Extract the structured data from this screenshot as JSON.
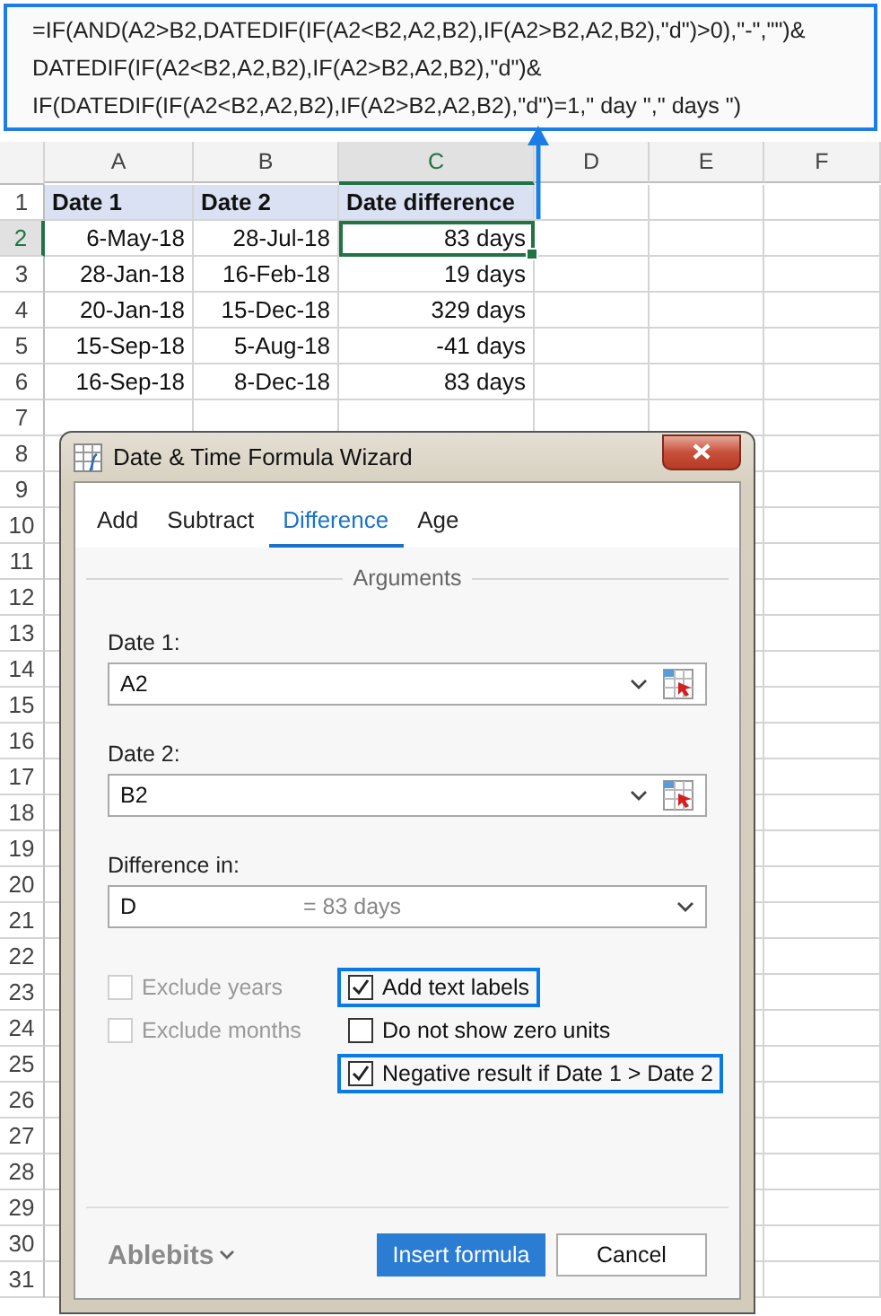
{
  "formula_box": {
    "lines": [
      "=IF(AND(A2>B2,DATEDIF(IF(A2<B2,A2,B2),IF(A2>B2,A2,B2),\"d\")>0),\"-\",\"\")&",
      "DATEDIF(IF(A2<B2,A2,B2),IF(A2>B2,A2,B2),\"d\")&",
      "IF(DATEDIF(IF(A2<B2,A2,B2),IF(A2>B2,A2,B2),\"d\")=1,\" day \",\" days \")"
    ]
  },
  "sheet": {
    "columns": [
      {
        "label": "A",
        "selected": false
      },
      {
        "label": "B",
        "selected": false
      },
      {
        "label": "C",
        "selected": true
      },
      {
        "label": "D",
        "selected": false
      },
      {
        "label": "E",
        "selected": false
      },
      {
        "label": "F",
        "selected": false
      }
    ],
    "rows": [
      {
        "label": "1",
        "selected": false,
        "kind": "header",
        "cells": [
          "Date 1",
          "Date 2",
          "Date difference"
        ]
      },
      {
        "label": "2",
        "selected": true,
        "kind": "data",
        "cells": [
          "6-May-18",
          "28-Jul-18",
          "83 days"
        ]
      },
      {
        "label": "3",
        "selected": false,
        "kind": "data",
        "cells": [
          "28-Jan-18",
          "16-Feb-18",
          "19 days"
        ]
      },
      {
        "label": "4",
        "selected": false,
        "kind": "data",
        "cells": [
          "20-Jan-18",
          "15-Dec-18",
          "329 days"
        ]
      },
      {
        "label": "5",
        "selected": false,
        "kind": "data",
        "cells": [
          "15-Sep-18",
          "5-Aug-18",
          "-41 days"
        ]
      },
      {
        "label": "6",
        "selected": false,
        "kind": "data",
        "cells": [
          "16-Sep-18",
          "8-Dec-18",
          "83 days"
        ]
      },
      {
        "label": "7",
        "selected": false,
        "kind": "data"
      },
      {
        "label": "8",
        "selected": false,
        "kind": "data"
      },
      {
        "label": "9",
        "selected": false,
        "kind": "data"
      },
      {
        "label": "10",
        "selected": false,
        "kind": "data"
      },
      {
        "label": "11",
        "selected": false,
        "kind": "data"
      },
      {
        "label": "12",
        "selected": false,
        "kind": "data"
      },
      {
        "label": "13",
        "selected": false,
        "kind": "data"
      },
      {
        "label": "14",
        "selected": false,
        "kind": "data"
      },
      {
        "label": "15",
        "selected": false,
        "kind": "data"
      },
      {
        "label": "16",
        "selected": false,
        "kind": "data"
      },
      {
        "label": "17",
        "selected": false,
        "kind": "data"
      },
      {
        "label": "18",
        "selected": false,
        "kind": "data"
      },
      {
        "label": "19",
        "selected": false,
        "kind": "data"
      },
      {
        "label": "20",
        "selected": false,
        "kind": "data"
      },
      {
        "label": "21",
        "selected": false,
        "kind": "data"
      },
      {
        "label": "22",
        "selected": false,
        "kind": "data"
      },
      {
        "label": "23",
        "selected": false,
        "kind": "data"
      },
      {
        "label": "24",
        "selected": false,
        "kind": "data"
      },
      {
        "label": "25",
        "selected": false,
        "kind": "data"
      },
      {
        "label": "26",
        "selected": false,
        "kind": "data"
      },
      {
        "label": "27",
        "selected": false,
        "kind": "data"
      },
      {
        "label": "28",
        "selected": false,
        "kind": "data"
      },
      {
        "label": "29",
        "selected": false,
        "kind": "data"
      },
      {
        "label": "30",
        "selected": false,
        "kind": "data"
      },
      {
        "label": "31",
        "selected": false,
        "kind": "data"
      }
    ]
  },
  "dialog": {
    "title": "Date & Time Formula Wizard",
    "tabs": [
      {
        "label": "Add",
        "selected": false
      },
      {
        "label": "Subtract",
        "selected": false
      },
      {
        "label": "Difference",
        "selected": true
      },
      {
        "label": "Age",
        "selected": false
      }
    ],
    "section": "Arguments",
    "fields": [
      {
        "label": "Date 1:",
        "value": "A2",
        "kind": "reference"
      },
      {
        "label": "Date 2:",
        "value": "B2",
        "kind": "reference"
      },
      {
        "label": "Difference in:",
        "value": "D",
        "hint": "= 83 days",
        "kind": "dropdown"
      }
    ],
    "left_options": [
      {
        "label": "Exclude years",
        "checked": false,
        "disabled": true,
        "highlighted": false
      },
      {
        "label": "Exclude months",
        "checked": false,
        "disabled": true,
        "highlighted": false
      }
    ],
    "right_options": [
      {
        "label": "Add text labels",
        "checked": true,
        "disabled": false,
        "highlighted": true
      },
      {
        "label": "Do not show zero units",
        "checked": false,
        "disabled": false,
        "highlighted": false
      },
      {
        "label": "Negative result if Date 1 > Date 2",
        "checked": true,
        "disabled": false,
        "highlighted": true
      }
    ],
    "brand": "Ablebits",
    "buttons": [
      {
        "label": "Insert formula",
        "primary": true
      },
      {
        "label": "Cancel",
        "primary": false
      }
    ]
  }
}
